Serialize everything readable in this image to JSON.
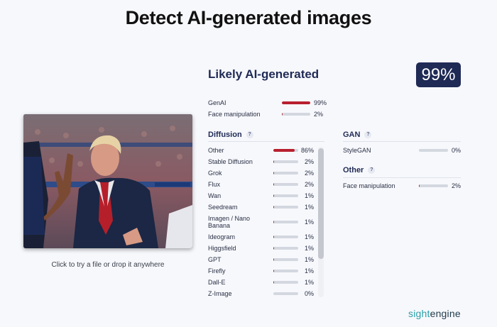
{
  "header": {
    "title": "Detect AI-generated images"
  },
  "preview": {
    "hint": "Click to try a file or drop it anywhere"
  },
  "result": {
    "verdict": "Likely AI-generated",
    "score": "99%"
  },
  "summary": [
    {
      "label": "GenAI",
      "value": "99%",
      "fraction": 0.99,
      "color": "#b8202f"
    },
    {
      "label": "Face manipulation",
      "value": "2%",
      "fraction": 0.02,
      "color": "#b8202f"
    }
  ],
  "diffusion": {
    "title": "Diffusion",
    "help": "?",
    "items": [
      {
        "label": "Other",
        "value": "86%",
        "fraction": 0.86
      },
      {
        "label": "Stable Diffusion",
        "value": "2%",
        "fraction": 0.02
      },
      {
        "label": "Grok",
        "value": "2%",
        "fraction": 0.02
      },
      {
        "label": "Flux",
        "value": "2%",
        "fraction": 0.02
      },
      {
        "label": "Wan",
        "value": "1%",
        "fraction": 0.01
      },
      {
        "label": "Seedream",
        "value": "1%",
        "fraction": 0.01
      },
      {
        "label": "Imagen / Nano Banana",
        "value": "1%",
        "fraction": 0.01
      },
      {
        "label": "Ideogram",
        "value": "1%",
        "fraction": 0.01
      },
      {
        "label": "Higgsfield",
        "value": "1%",
        "fraction": 0.01
      },
      {
        "label": "GPT",
        "value": "1%",
        "fraction": 0.01
      },
      {
        "label": "Firefly",
        "value": "1%",
        "fraction": 0.01
      },
      {
        "label": "Dall-E",
        "value": "1%",
        "fraction": 0.01
      },
      {
        "label": "Z-Image",
        "value": "0%",
        "fraction": 0.0
      }
    ]
  },
  "gan": {
    "title": "GAN",
    "help": "?",
    "items": [
      {
        "label": "StyleGAN",
        "value": "0%",
        "fraction": 0.0
      }
    ]
  },
  "other": {
    "title": "Other",
    "help": "?",
    "items": [
      {
        "label": "Face manipulation",
        "value": "2%",
        "fraction": 0.02
      }
    ]
  },
  "brand": {
    "part1": "sight",
    "part2": "engine"
  },
  "colors": {
    "accent": "#b8202f",
    "navy": "#1f2a55",
    "brand": "#2aa0a8"
  }
}
